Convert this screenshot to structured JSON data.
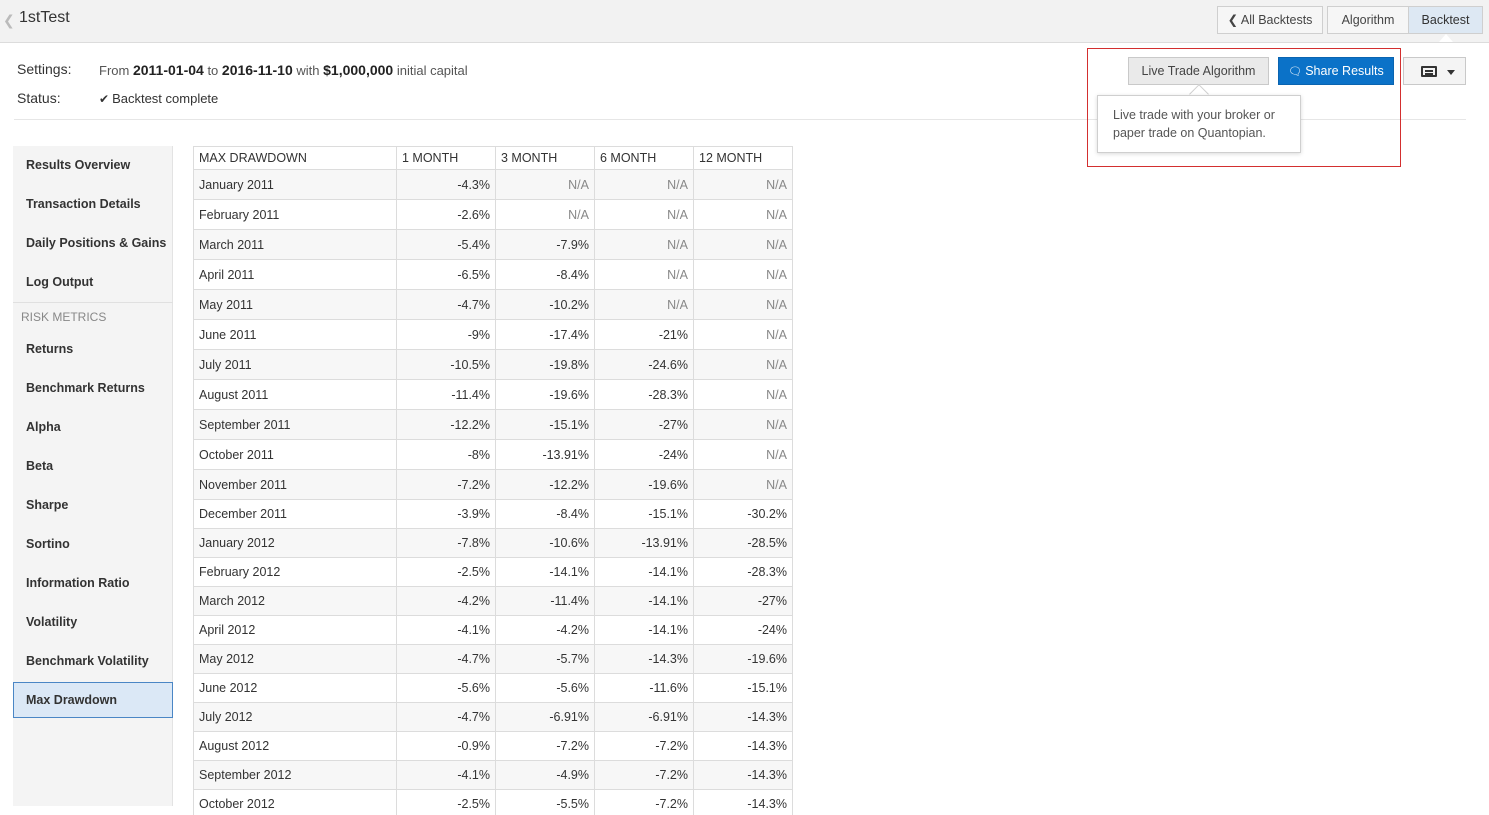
{
  "header": {
    "title": "1stTest",
    "nav": {
      "all_backtests": "All Backtests",
      "algorithm": "Algorithm",
      "backtest": "Backtest"
    }
  },
  "settings": {
    "settings_label": "Settings:",
    "status_label": "Status:",
    "from_word": "From",
    "start_date": "2011-01-04",
    "to_word": "to",
    "end_date": "2016-11-10",
    "with_word": "with",
    "capital": "$1,000,000",
    "capital_suffix": "initial capital",
    "status": "Backtest complete"
  },
  "actions": {
    "live_trade": "Live Trade Algorithm",
    "share": "Share Results",
    "tooltip": "Live trade with your broker or paper trade on Quantopian."
  },
  "sidebar": {
    "items": [
      {
        "label": "Results Overview"
      },
      {
        "label": "Transaction Details"
      },
      {
        "label": "Daily Positions & Gains"
      },
      {
        "label": "Log Output"
      }
    ],
    "risk_header": "RISK METRICS",
    "risk_items": [
      {
        "label": "Returns"
      },
      {
        "label": "Benchmark Returns"
      },
      {
        "label": "Alpha"
      },
      {
        "label": "Beta"
      },
      {
        "label": "Sharpe"
      },
      {
        "label": "Sortino"
      },
      {
        "label": "Information Ratio"
      },
      {
        "label": "Volatility"
      },
      {
        "label": "Benchmark Volatility"
      },
      {
        "label": "Max Drawdown"
      }
    ],
    "active": "Max Drawdown"
  },
  "table": {
    "columns": [
      "MAX DRAWDOWN",
      "1 MONTH",
      "3 MONTH",
      "6 MONTH",
      "12 MONTH"
    ],
    "rows": [
      [
        "January 2011",
        "-4.3%",
        "N/A",
        "N/A",
        "N/A"
      ],
      [
        "February 2011",
        "-2.6%",
        "N/A",
        "N/A",
        "N/A"
      ],
      [
        "March 2011",
        "-5.4%",
        "-7.9%",
        "N/A",
        "N/A"
      ],
      [
        "April 2011",
        "-6.5%",
        "-8.4%",
        "N/A",
        "N/A"
      ],
      [
        "May 2011",
        "-4.7%",
        "-10.2%",
        "N/A",
        "N/A"
      ],
      [
        "June 2011",
        "-9%",
        "-17.4%",
        "-21%",
        "N/A"
      ],
      [
        "July 2011",
        "-10.5%",
        "-19.8%",
        "-24.6%",
        "N/A"
      ],
      [
        "August 2011",
        "-11.4%",
        "-19.6%",
        "-28.3%",
        "N/A"
      ],
      [
        "September 2011",
        "-12.2%",
        "-15.1%",
        "-27%",
        "N/A"
      ],
      [
        "October 2011",
        "-8%",
        "-13.91%",
        "-24%",
        "N/A"
      ],
      [
        "November 2011",
        "-7.2%",
        "-12.2%",
        "-19.6%",
        "N/A"
      ],
      [
        "December 2011",
        "-3.9%",
        "-8.4%",
        "-15.1%",
        "-30.2%"
      ],
      [
        "January 2012",
        "-7.8%",
        "-10.6%",
        "-13.91%",
        "-28.5%"
      ],
      [
        "February 2012",
        "-2.5%",
        "-14.1%",
        "-14.1%",
        "-28.3%"
      ],
      [
        "March 2012",
        "-4.2%",
        "-11.4%",
        "-14.1%",
        "-27%"
      ],
      [
        "April 2012",
        "-4.1%",
        "-4.2%",
        "-14.1%",
        "-24%"
      ],
      [
        "May 2012",
        "-4.7%",
        "-5.7%",
        "-14.3%",
        "-19.6%"
      ],
      [
        "June 2012",
        "-5.6%",
        "-5.6%",
        "-11.6%",
        "-15.1%"
      ],
      [
        "July 2012",
        "-4.7%",
        "-6.91%",
        "-6.91%",
        "-14.3%"
      ],
      [
        "August 2012",
        "-0.9%",
        "-7.2%",
        "-7.2%",
        "-14.3%"
      ],
      [
        "September 2012",
        "-4.1%",
        "-4.9%",
        "-7.2%",
        "-14.3%"
      ],
      [
        "October 2012",
        "-2.5%",
        "-5.5%",
        "-7.2%",
        "-14.3%"
      ]
    ]
  },
  "icons": {
    "back": "chevron-left-icon",
    "check": "check-icon",
    "share": "comments-icon",
    "menu": "list-icon",
    "menu_caret": "caret-down-icon"
  },
  "colors": {
    "share_button": "#0b72c8",
    "active_tab": "#dde8f3",
    "highlight_box": "#d32f2f",
    "active_sidebar": "#dbe8f6"
  }
}
